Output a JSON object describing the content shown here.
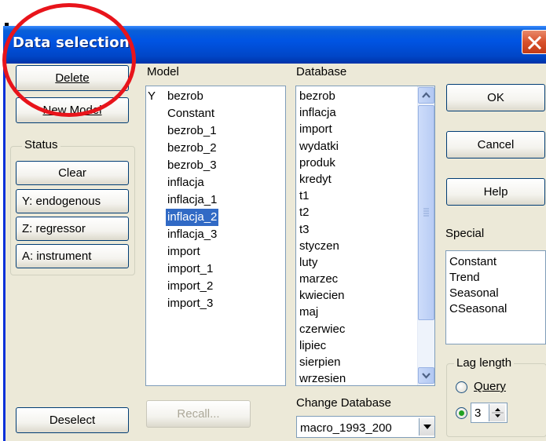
{
  "window": {
    "title": "Data selection",
    "close_icon": "close-icon"
  },
  "left_panel": {
    "delete_label": "Delete",
    "new_model_label": "New Model",
    "status_label": "Status",
    "clear_label": "Clear",
    "endogenous_label": "Y: endogenous",
    "regressor_label": "Z: regressor",
    "instrument_label": "A: instrument",
    "deselect_label": "Deselect"
  },
  "model": {
    "label": "Model",
    "items": [
      {
        "flag": "Y",
        "name": "bezrob"
      },
      {
        "flag": "",
        "name": "Constant"
      },
      {
        "flag": "",
        "name": "bezrob_1"
      },
      {
        "flag": "",
        "name": "bezrob_2"
      },
      {
        "flag": "",
        "name": "bezrob_3"
      },
      {
        "flag": "",
        "name": "inflacja"
      },
      {
        "flag": "",
        "name": "inflacja_1"
      },
      {
        "flag": "",
        "name": "inflacja_2"
      },
      {
        "flag": "",
        "name": "inflacja_3"
      },
      {
        "flag": "",
        "name": "import"
      },
      {
        "flag": "",
        "name": "import_1"
      },
      {
        "flag": "",
        "name": "import_2"
      },
      {
        "flag": "",
        "name": "import_3"
      }
    ],
    "selected_index": 7,
    "recall_label": "Recall..."
  },
  "database": {
    "label": "Database",
    "items": [
      "bezrob",
      "inflacja",
      "import",
      "wydatki",
      "produk",
      "kredyt",
      "t1",
      "t2",
      "t3",
      "styczen",
      "luty",
      "marzec",
      "kwiecien",
      "maj",
      "czerwiec",
      "lipiec",
      "sierpien",
      "wrzesien"
    ],
    "change_label": "Change Database",
    "current": "macro_1993_200"
  },
  "right_panel": {
    "ok_label": "OK",
    "cancel_label": "Cancel",
    "help_label": "Help",
    "special_label": "Special",
    "special_items": [
      "Constant",
      "Trend",
      "Seasonal",
      "CSeasonal"
    ],
    "lag_label": "Lag length",
    "query_label": "Query",
    "lag_value": "3"
  },
  "colors": {
    "titlebar": "#0054e3",
    "selection": "#316ac5",
    "annotation": "#e8141b",
    "dialog_bg": "#ece9d8"
  }
}
